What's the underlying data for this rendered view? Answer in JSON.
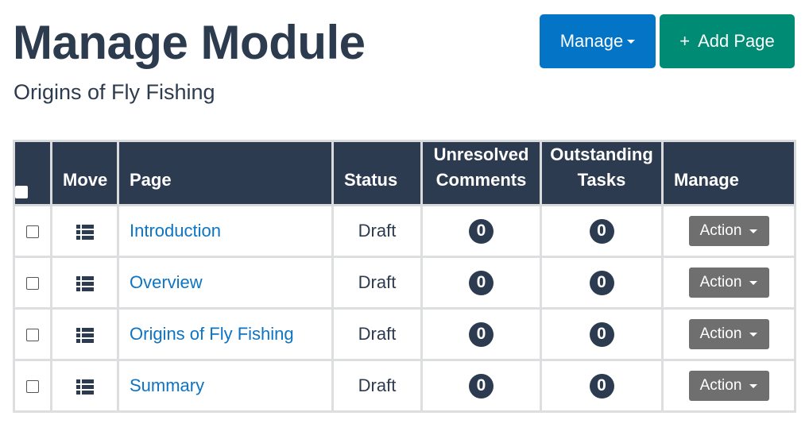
{
  "header": {
    "title": "Manage Module",
    "subtitle": "Origins of Fly Fishing"
  },
  "toolbar": {
    "manage_label": "Manage",
    "add_page_label": "Add Page",
    "add_page_icon": "+"
  },
  "table": {
    "columns": {
      "move": "Move",
      "page": "Page",
      "status": "Status",
      "unresolved_line1": "Unresolved",
      "unresolved_line2": "Comments",
      "outstanding_line1": "Outstanding",
      "outstanding_line2": "Tasks",
      "manage": "Manage"
    },
    "rows": [
      {
        "page": "Introduction",
        "status": "Draft",
        "unresolved": "0",
        "outstanding": "0",
        "action": "Action"
      },
      {
        "page": "Overview",
        "status": "Draft",
        "unresolved": "0",
        "outstanding": "0",
        "action": "Action"
      },
      {
        "page": "Origins of Fly Fishing",
        "status": "Draft",
        "unresolved": "0",
        "outstanding": "0",
        "action": "Action"
      },
      {
        "page": "Summary",
        "status": "Draft",
        "unresolved": "0",
        "outstanding": "0",
        "action": "Action"
      }
    ]
  },
  "icons": {
    "move": "list-icon",
    "dropdown": "caret-down-icon",
    "select": "checkbox"
  },
  "colors": {
    "primary_blue": "#0374c6",
    "add_green": "#008b74",
    "header_navy": "#2c3b50",
    "link_blue": "#0d74c4",
    "action_gray": "#6f6f6f"
  }
}
